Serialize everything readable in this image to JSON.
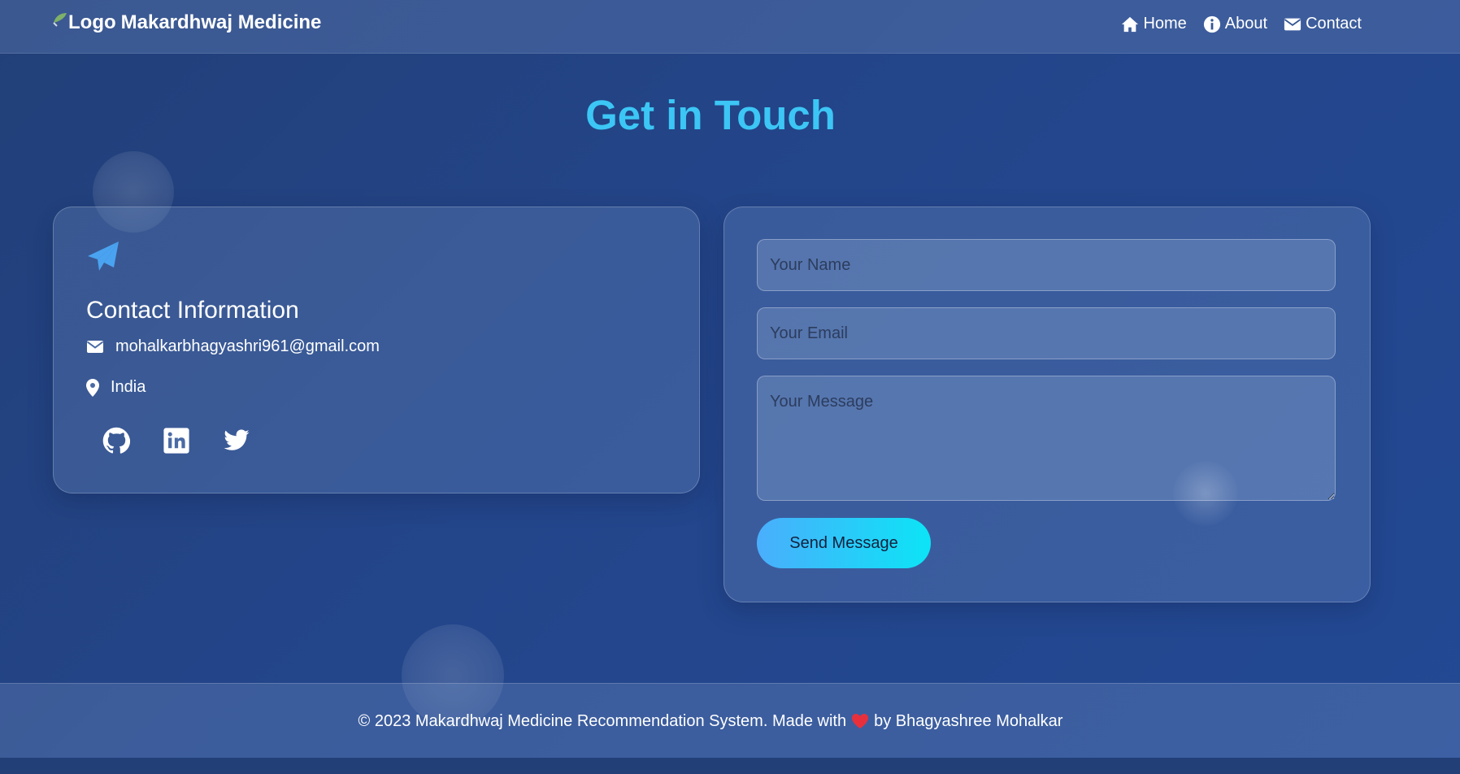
{
  "nav": {
    "logo_alt": "Logo",
    "brand": "Makardhwaj Medicine",
    "links": [
      {
        "label": "Home",
        "icon": "home-icon"
      },
      {
        "label": "About",
        "icon": "info-icon"
      },
      {
        "label": "Contact",
        "icon": "envelope-icon"
      }
    ]
  },
  "page": {
    "title": "Get in Touch"
  },
  "contact_info": {
    "icon": "paper-plane-icon",
    "title": "Contact Information",
    "email": "mohalkarbhagyashri961@gmail.com",
    "location": "India",
    "socials": [
      "github-icon",
      "linkedin-icon",
      "twitter-icon"
    ]
  },
  "form": {
    "name_placeholder": "Your Name",
    "email_placeholder": "Your Email",
    "message_placeholder": "Your Message",
    "submit_label": "Send Message"
  },
  "footer": {
    "text_before": "© 2023 Makardhwaj Medicine Recommendation System. Made with",
    "text_after": "by Bhagyashree Mohalkar"
  },
  "colors": {
    "accent": "#3cc6f5",
    "button_start": "#4aaefc",
    "button_end": "#0ce4f6",
    "heart": "#e8303d"
  }
}
